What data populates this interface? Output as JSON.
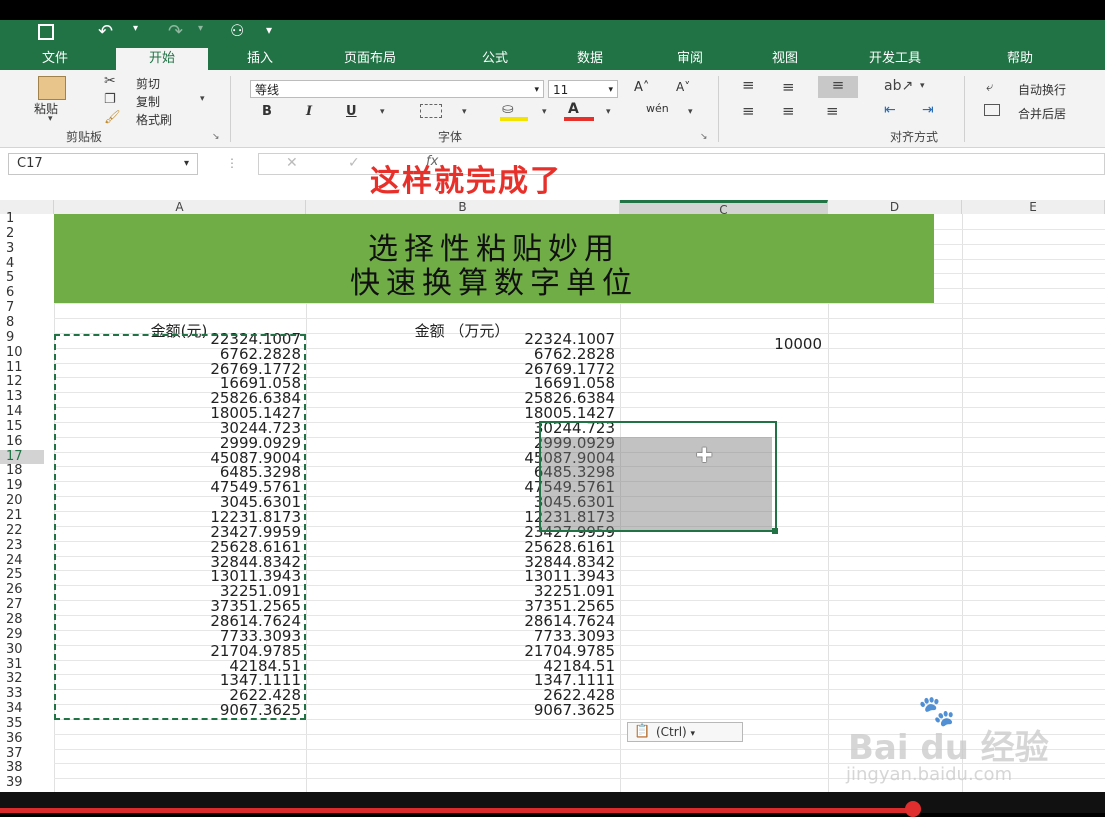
{
  "ribbon": {
    "tabs": [
      "文件",
      "开始",
      "插入",
      "页面布局",
      "公式",
      "数据",
      "审阅",
      "视图",
      "开发工具",
      "帮助"
    ],
    "active_tab": "开始",
    "paste_label": "粘贴",
    "cut_label": "剪切",
    "copy_label": "复制",
    "format_painter_label": "格式刷",
    "clipboard_group": "剪贴板",
    "font_name": "等线",
    "font_size": "11",
    "bold": "B",
    "italic": "I",
    "underline": "U",
    "font_group": "字体",
    "wrap_text": "自动换行",
    "merge_center": "合并后居",
    "alignment_group": "对齐方式"
  },
  "formula_bar": {
    "name_box": "C17",
    "caption": "这样就完成了"
  },
  "sheet": {
    "columns": [
      "A",
      "B",
      "C",
      "D",
      "E"
    ],
    "rows": [
      "1",
      "2",
      "3",
      "4",
      "5",
      "6",
      "7",
      "8",
      "9",
      "10",
      "11",
      "12",
      "13",
      "14",
      "15",
      "16",
      "17",
      "18",
      "19",
      "20",
      "21",
      "22",
      "23",
      "24",
      "25",
      "26",
      "27",
      "28",
      "29",
      "30",
      "31",
      "32",
      "33",
      "34",
      "35",
      "36",
      "37",
      "38",
      "39"
    ],
    "banner_line1": "选择性粘贴妙用",
    "banner_line2": "快速换算数字单位",
    "header_a": "金额(元)",
    "header_b": "金额 （万元）",
    "c9_value": "10000",
    "values_a": [
      "22324.1007",
      "6762.2828",
      "26769.1772",
      "16691.058",
      "25826.6384",
      "18005.1427",
      "30244.723",
      "2999.0929",
      "45087.9004",
      "6485.3298",
      "47549.5761",
      "3045.6301",
      "12231.8173",
      "23427.9959",
      "25628.6161",
      "32844.8342",
      "13011.3943",
      "32251.091",
      "37351.2565",
      "28614.7624",
      "7733.3093",
      "21704.9785",
      "42184.51",
      "1347.1111",
      "2622.428",
      "9067.3625"
    ],
    "values_b": [
      "22324.1007",
      "6762.2828",
      "26769.1772",
      "16691.058",
      "25826.6384",
      "18005.1427",
      "30244.723",
      "2999.0929",
      "45087.9004",
      "6485.3298",
      "47549.5761",
      "3045.6301",
      "12231.8173",
      "23427.9959",
      "25628.6161",
      "32844.8342",
      "13011.3943",
      "32251.091",
      "37351.2565",
      "28614.7624",
      "7733.3093",
      "21704.9785",
      "42184.51",
      "1347.1111",
      "2622.428",
      "9067.3625"
    ],
    "paste_options": "(Ctrl)"
  },
  "watermark": {
    "brand": "Bai du 经验",
    "url": "jingyan.baidu.com"
  },
  "colors": {
    "excel_green": "#217346",
    "banner_green": "#70ad47",
    "caption_red": "#e8302b"
  }
}
